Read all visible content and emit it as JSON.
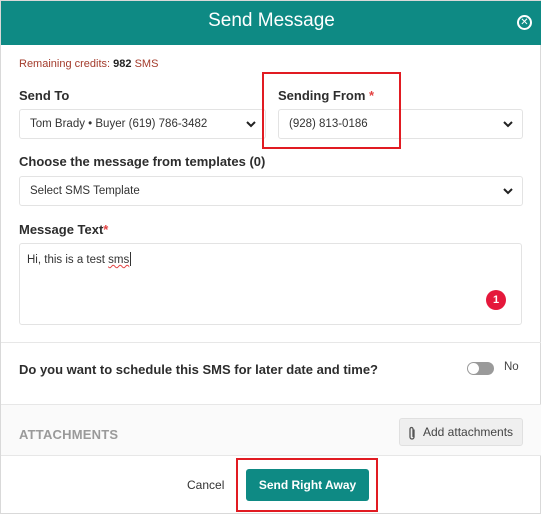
{
  "header": {
    "title": "Send Message",
    "close_icon": "close-circle-icon"
  },
  "credits": {
    "label": "Remaining credits:",
    "count": "982",
    "unit": "SMS"
  },
  "send_to": {
    "label": "Send To",
    "value": "Tom Brady • Buyer (619) 786-3482"
  },
  "sending_from": {
    "label": "Sending From",
    "required_mark": "*",
    "value": "(928) 813-0186"
  },
  "templates": {
    "label": "Choose the message from templates (0)",
    "value": "Select SMS Template"
  },
  "message": {
    "label": "Message Text",
    "required_mark": "*",
    "text_before": "Hi, this is a test ",
    "text_misspelled": "sms",
    "badge_count": "1"
  },
  "schedule": {
    "question": "Do you want to schedule this SMS for later date and time?",
    "toggle_state": "No"
  },
  "attachments": {
    "title": "ATTACHMENTS",
    "add_label": "Add attachments"
  },
  "footer": {
    "cancel_label": "Cancel",
    "send_label": "Send Right Away"
  },
  "colors": {
    "primary": "#0e8a84",
    "highlight": "#e11b22",
    "badge": "#e5183b",
    "credits_text": "#a33b2b"
  }
}
